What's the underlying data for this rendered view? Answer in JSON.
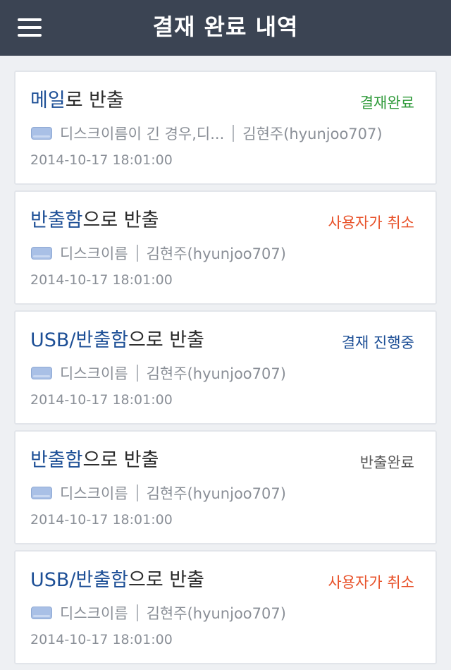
{
  "header": {
    "title": "결재 완료 내역",
    "menu_icon": "hamburger-menu-icon"
  },
  "colors": {
    "header_bg": "#3b4453",
    "method_blue": "#1d4f96",
    "status_done_green": "#2f9a3a",
    "status_cancel_red": "#e8522a",
    "status_progress_blue": "#1d4f96",
    "status_export_gray": "#555555"
  },
  "items": [
    {
      "method": "메일",
      "suffix": "로 반출",
      "status": "결재완료",
      "status_color": "#2f9a3a",
      "disk": "디스크이름이 긴 경우,디...",
      "user": "김현주(hyunjoo707)",
      "date": "2014-10-17 18:01:00"
    },
    {
      "method": "반출함",
      "suffix": "으로 반출",
      "status": "사용자가 취소",
      "status_color": "#e8522a",
      "disk": "디스크이름",
      "user": "김현주(hyunjoo707)",
      "date": "2014-10-17 18:01:00"
    },
    {
      "method": "USB/반출함",
      "suffix": "으로 반출",
      "status": "결재 진행중",
      "status_color": "#1d4f96",
      "disk": "디스크이름",
      "user": "김현주(hyunjoo707)",
      "date": "2014-10-17 18:01:00"
    },
    {
      "method": "반출함",
      "suffix": "으로 반출",
      "status": "반출완료",
      "status_color": "#555555",
      "disk": "디스크이름",
      "user": "김현주(hyunjoo707)",
      "date": "2014-10-17 18:01:00"
    },
    {
      "method": "USB/반출함",
      "suffix": "으로 반출",
      "status": "사용자가 취소",
      "status_color": "#e8522a",
      "disk": "디스크이름",
      "user": "김현주(hyunjoo707)",
      "date": "2014-10-17 18:01:00"
    }
  ]
}
